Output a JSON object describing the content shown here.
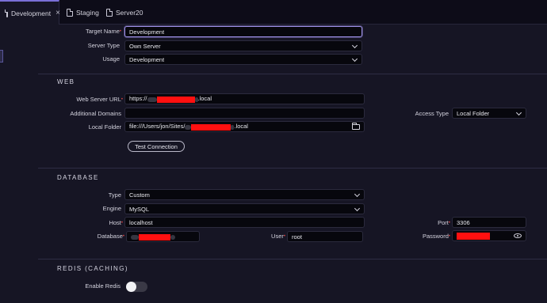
{
  "tabs": [
    {
      "label": "Development",
      "active": true,
      "closable": true,
      "icon": "file-icon"
    },
    {
      "label": "Staging",
      "active": false,
      "icon": "file-icon"
    },
    {
      "label": "Server20",
      "active": false,
      "icon": "file-icon"
    }
  ],
  "general": {
    "target_name_label": "Target Name",
    "target_name_value": "Development",
    "server_type_label": "Server Type",
    "server_type_value": "Own Server",
    "usage_label": "Usage",
    "usage_value": "Development"
  },
  "web": {
    "title": "WEB",
    "server_url_label": "Web Server URL",
    "server_url_prefix": "https://",
    "server_url_suffix": ".local",
    "additional_domains_label": "Additional Domains",
    "additional_domains_value": "",
    "access_type_label": "Access Type",
    "access_type_value": "Local Folder",
    "local_folder_label": "Local Folder",
    "local_folder_prefix": "file:///Users/jon/Sites/",
    "local_folder_suffix": ".local",
    "test_connection_label": "Test Connection"
  },
  "database": {
    "title": "DATABASE",
    "type_label": "Type",
    "type_value": "Custom",
    "engine_label": "Engine",
    "engine_value": "MySQL",
    "host_label": "Host",
    "host_value": "localhost",
    "port_label": "Port",
    "port_value": "3306",
    "database_label": "Database",
    "user_label": "User",
    "user_value": "root",
    "password_label": "Password"
  },
  "redis": {
    "title": "REDIS (CACHING)",
    "enable_label": "Enable Redis",
    "enabled": false
  },
  "colors": {
    "background": "#161524",
    "tabbar": "#0d0c18",
    "accent": "#9d90e6",
    "required": "#e04545",
    "redaction": "#ff1010"
  }
}
